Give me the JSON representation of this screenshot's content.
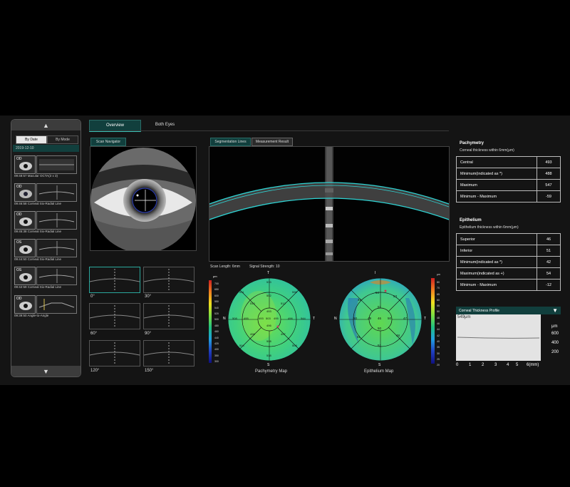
{
  "sidebar": {
    "tabs": [
      "By Date",
      "By Mode"
    ],
    "date": "2019-12-10",
    "history": [
      {
        "eye": "OD",
        "caption": "09:48:57 Macular OCTA(3 x 3)"
      },
      {
        "eye": "OD",
        "caption": "09:46:58 Corneal Six-Radial Line"
      },
      {
        "eye": "OD",
        "caption": "09:45:38 Corneal Six-Radial Line"
      },
      {
        "eye": "OS",
        "caption": "09:44:50 Corneal Six-Radial Line"
      },
      {
        "eye": "OS",
        "caption": "09:42:59 Corneal Six-Radial Line"
      },
      {
        "eye": "OD",
        "caption": "09:39:50 Angle-to-Angle"
      }
    ],
    "scroll_up": "▲",
    "scroll_down": "▼"
  },
  "tabs": {
    "overview": "Overview",
    "both_eyes": "Both Eyes"
  },
  "scan_navigator": {
    "label": "Scan Navigator"
  },
  "bscan": {
    "tabs": [
      "Segmentation Lines",
      "Measurement Result"
    ],
    "scan_length": "Scan Length: 6mm",
    "signal_strength": "Signal Strength: 10"
  },
  "radial_scans": {
    "angles": [
      "0°",
      "30°",
      "60°",
      "90°",
      "120°",
      "150°"
    ]
  },
  "pachymetry_map": {
    "caption": "Pachymetry Map",
    "unit": "μm",
    "scale": [
      "700",
      "650",
      "600",
      "550",
      "540",
      "520",
      "500",
      "480",
      "460",
      "440",
      "420",
      "400",
      "350",
      "300"
    ],
    "directions": {
      "top": "T",
      "bottom": "S",
      "left": "N",
      "right": "T"
    },
    "values": {
      "outer": [
        "533",
        "596",
        "544",
        "508",
        "518",
        "504",
        "508",
        "511"
      ],
      "mid": [
        "502",
        "512",
        "496",
        "497",
        "508",
        "496",
        "495",
        "510"
      ],
      "inner": [
        "493",
        "495",
        "496",
        "493",
        "493"
      ],
      "center": "503"
    }
  },
  "epithelium_map": {
    "caption": "Epithelium Map",
    "unit": "μm",
    "scale": [
      "80",
      "70",
      "65",
      "60",
      "55",
      "50",
      "48",
      "46",
      "44",
      "42",
      "40",
      "35",
      "30",
      "25",
      "20"
    ],
    "directions": {
      "top": "I",
      "bottom": "S",
      "left": "N",
      "right": "T"
    },
    "values": [
      "54",
      "53",
      "47",
      "48",
      "51",
      "51",
      "50",
      "51",
      "50",
      "50",
      "49",
      "46",
      "46"
    ]
  },
  "pachymetry": {
    "title": "Pachymetry",
    "subtitle": "Corneal thickness within 6mm(μm)",
    "rows": [
      {
        "label": "Central",
        "value": "493"
      },
      {
        "label": "Minimum(indicated as *)",
        "value": "488"
      },
      {
        "label": "Maximum",
        "value": "547"
      },
      {
        "label": "Minimum - Maximum",
        "value": "-59"
      }
    ]
  },
  "epithelium": {
    "title": "Epithelium",
    "subtitle": "Epithelium thickness within 6mm(μm)",
    "rows": [
      {
        "label": "Superior",
        "value": "46"
      },
      {
        "label": "Inferior",
        "value": "51"
      },
      {
        "label": "Minimum(indicated as *)",
        "value": "42"
      },
      {
        "label": "Maximum(indicated as +)",
        "value": "54"
      },
      {
        "label": "Minimum - Maximum",
        "value": "-12"
      }
    ]
  },
  "profile": {
    "title": "Corneal Thickness Profile",
    "readout": "549μm",
    "unit": "μm",
    "y_ticks": [
      "600",
      "400",
      "200"
    ],
    "x_ticks": [
      "0",
      "1",
      "2",
      "3",
      "4",
      "5",
      "6(mm)"
    ]
  },
  "colors": {
    "accent": "#36c2b6",
    "tab_active": "#113f3d",
    "segmentation": "#2fd3d3"
  }
}
